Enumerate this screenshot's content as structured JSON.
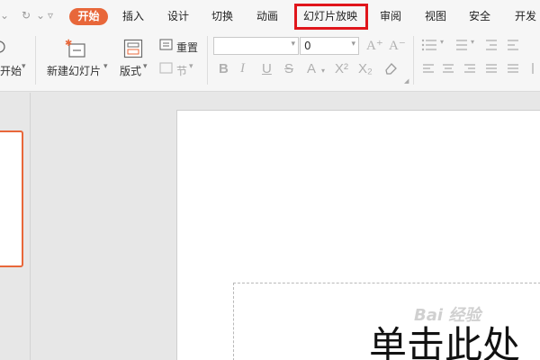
{
  "quick_access": {
    "redo_icon": "redo-icon",
    "dropdown_icon": "chevron-down-icon"
  },
  "tabs": [
    {
      "label": "开始",
      "active": true
    },
    {
      "label": "插入"
    },
    {
      "label": "设计"
    },
    {
      "label": "切换"
    },
    {
      "label": "动画"
    },
    {
      "label": "幻灯片放映",
      "highlighted": true
    },
    {
      "label": "审阅"
    },
    {
      "label": "视图"
    },
    {
      "label": "安全"
    },
    {
      "label": "开发"
    }
  ],
  "ribbon": {
    "start_show_label": "开始",
    "new_slide_label": "新建幻灯片",
    "layout_label": "版式",
    "reset_label": "重置",
    "section_label": "节",
    "font_name_value": "",
    "font_size_value": "0"
  },
  "slide": {
    "title_text": "单击此处"
  },
  "watermark": {
    "text": "Bai 经验"
  },
  "colors": {
    "accent": "#e8673a",
    "highlight_box": "#e0151b",
    "thumb_border": "#e8673a"
  }
}
